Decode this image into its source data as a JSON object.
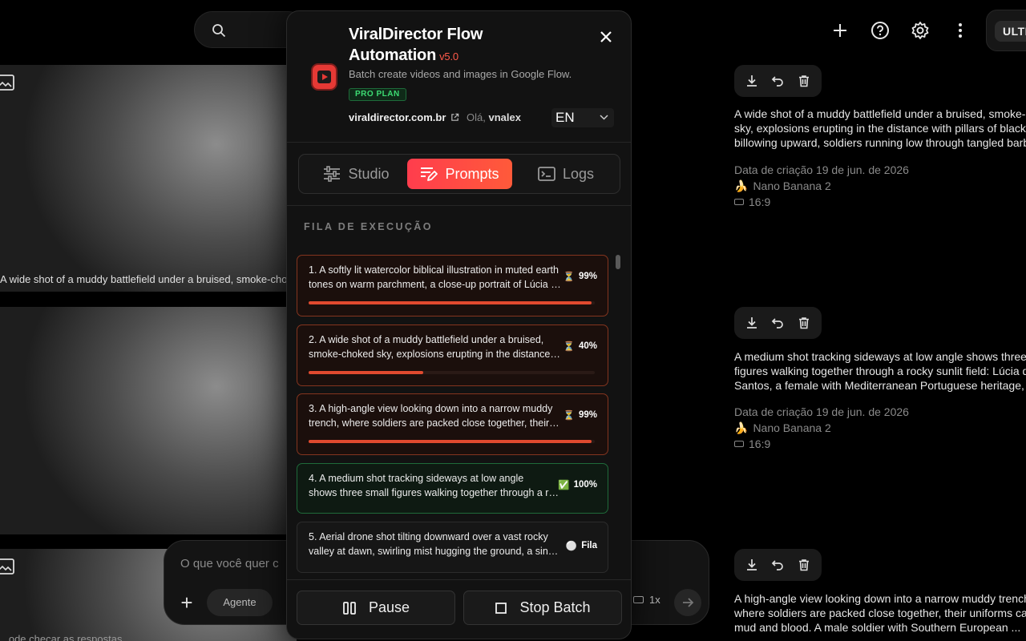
{
  "background": {
    "topbar": {
      "ultra_label": "ULTR",
      "icons": [
        "plus-icon",
        "help-icon",
        "settings-icon",
        "more-icon"
      ]
    },
    "thumb_caption": "A wide shot of a muddy battlefield under a bruised, smoke-cho",
    "cards": [
      {
        "lines": [
          "A wide shot of a muddy battlefield under a bruised, smoke-",
          "sky, explosions erupting in the distance with pillars of black",
          "billowing upward, soldiers running low through tangled barb"
        ],
        "date": "Data de criação 19 de jun. de 2026",
        "model": "Nano Banana 2",
        "ratio": "16:9"
      },
      {
        "lines": [
          "A medium shot tracking sideways at low angle shows three",
          "figures walking together through a rocky sunlit field: Lúcia d",
          "Santos, a female with Mediterranean Portuguese heritage, s"
        ],
        "date": "Data de criação 19 de jun. de 2026",
        "model": "Nano Banana 2",
        "ratio": "16:9"
      },
      {
        "lines": [
          "A high-angle view looking down into a narrow muddy trench",
          "where soldiers are packed close together, their uniforms ca",
          "mud and blood. A male soldier with Southern European ..."
        ]
      }
    ],
    "composer": {
      "placeholder": "O que você quer c",
      "agent_label": "Agente",
      "multiplier": "1x"
    },
    "bottom_note": "...ode checar as respostas"
  },
  "panel": {
    "title_line1": "ViralDirector Flow",
    "title_line2": "Automation",
    "version": "v5.0",
    "subtitle": "Batch create videos and images in Google Flow.",
    "plan_badge": "PRO PLAN",
    "site": "viraldirector.com.br",
    "greeting": "Olá,",
    "username": "vnalex",
    "language": "EN",
    "tabs": [
      {
        "label": "Studio",
        "active": false
      },
      {
        "label": "Prompts",
        "active": true
      },
      {
        "label": "Logs",
        "active": false
      }
    ],
    "queue_label": "FILA DE EXECUÇÃO",
    "queue": [
      {
        "line1": "1. A softly lit watercolor biblical illustration in muted earth",
        "line2": "tones on warm parchment, a close-up portrait of Lúcia dos Santos",
        "status_icon": "⏳",
        "status": "99%",
        "progress": 99,
        "state": "running"
      },
      {
        "line1": "2. A wide shot of a muddy battlefield under a bruised,",
        "line2": "smoke-choked sky, explosions erupting in the distance with",
        "status_icon": "⏳",
        "status": "40%",
        "progress": 40,
        "state": "running"
      },
      {
        "line1": "3. A high-angle view looking down into a narrow muddy",
        "line2": "trench, where soldiers are packed close together, their uniforms",
        "status_icon": "⏳",
        "status": "99%",
        "progress": 99,
        "state": "running"
      },
      {
        "line1": "4. A medium shot tracking sideways at low angle",
        "line2": "shows three small figures walking together through a rocky field",
        "status_icon": "✅",
        "status": "100%",
        "progress": 100,
        "state": "done"
      },
      {
        "line1": "5. Aerial drone shot tilting downward over a vast rocky",
        "line2": "valley at dawn, swirling mist hugging the ground, a single road",
        "status_icon": "⚪",
        "status": "Fila",
        "progress": 0,
        "state": "queued"
      }
    ],
    "pause_label": "Pause",
    "stop_label": "Stop Batch"
  }
}
